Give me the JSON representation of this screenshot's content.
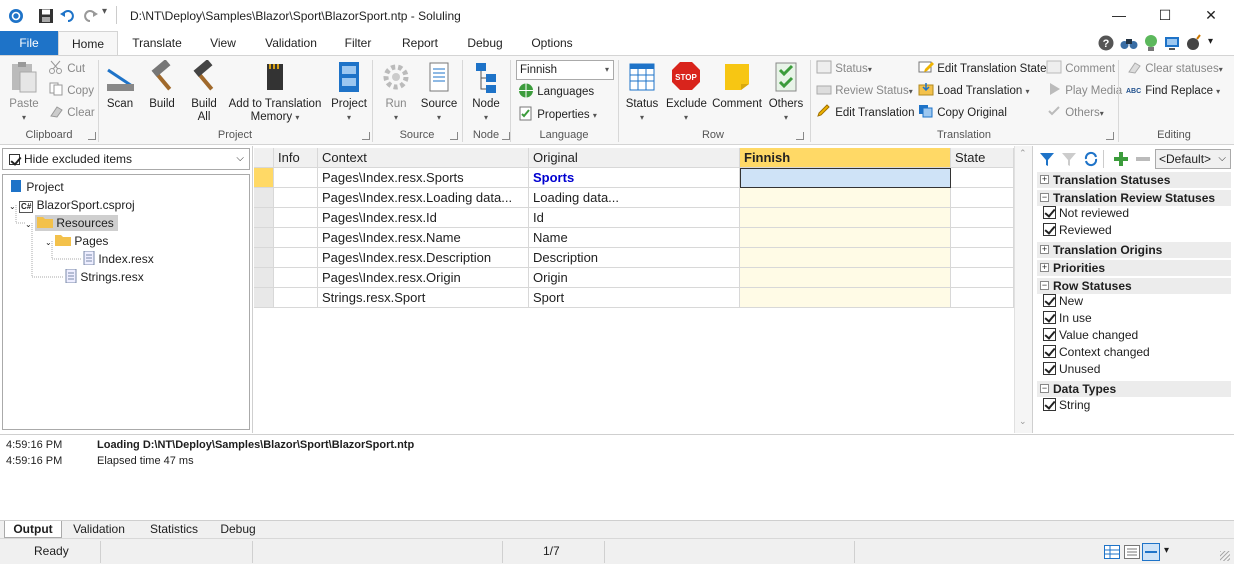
{
  "window": {
    "title": "D:\\NT\\Deploy\\Samples\\Blazor\\Sport\\BlazorSport.ntp  -  Soluling",
    "minimize": "—",
    "maximize": "☐",
    "close": "✕"
  },
  "tabs": [
    "File",
    "Home",
    "Translate",
    "View",
    "Validation",
    "Filter",
    "Report",
    "Debug",
    "Options"
  ],
  "ribbon": {
    "clipboard": {
      "paste": "Paste",
      "cut": "Cut",
      "copy": "Copy",
      "clear": "Clear",
      "label": "Clipboard"
    },
    "project": {
      "scan": "Scan",
      "build": "Build",
      "build_all_1": "Build",
      "build_all_2": "All",
      "add_tm_1": "Add to Translation",
      "add_tm_2": "Memory",
      "project": "Project",
      "label": "Project"
    },
    "source": {
      "run": "Run",
      "source": "Source",
      "label": "Source"
    },
    "node": {
      "node": "Node",
      "label": "Node"
    },
    "language": {
      "select": "Finnish",
      "languages": "Languages",
      "properties": "Properties",
      "label": "Language"
    },
    "row": {
      "status": "Status",
      "exclude": "Exclude",
      "comment": "Comment",
      "others": "Others",
      "label": "Row",
      "stop_text": "STOP"
    },
    "translation": {
      "status": "Status",
      "review_status": "Review Status",
      "edit_translation": "Edit Translation",
      "edit_state": "Edit Translation State",
      "load_translation": "Load Translation",
      "copy_original": "Copy Original",
      "comment": "Comment",
      "play_media": "Play Media",
      "others": "Others",
      "label": "Translation"
    },
    "editing": {
      "clear_statuses": "Clear statuses",
      "find_replace": "Find  Replace",
      "abc": "ABC",
      "label": "Editing"
    }
  },
  "left": {
    "filter": "Hide excluded items",
    "tree": [
      {
        "label": "Project",
        "icon": "project-icon"
      },
      {
        "label": "BlazorSport.csproj",
        "icon": "csharp-project-icon",
        "badge": "C#"
      },
      {
        "label": "Resources",
        "icon": "folder-icon"
      },
      {
        "label": "Pages",
        "icon": "folder-icon"
      },
      {
        "label": "Index.resx",
        "icon": "resx-file-icon"
      },
      {
        "label": "Strings.resx",
        "icon": "resx-file-icon"
      }
    ]
  },
  "grid": {
    "headers": [
      "Info",
      "Context",
      "Original",
      "Finnish",
      "State"
    ],
    "rows": [
      {
        "context": "Pages\\Index.resx.Sports",
        "original": "Sports"
      },
      {
        "context": "Pages\\Index.resx.Loading data...",
        "original": "Loading data..."
      },
      {
        "context": "Pages\\Index.resx.Id",
        "original": "Id"
      },
      {
        "context": "Pages\\Index.resx.Name",
        "original": "Name"
      },
      {
        "context": "Pages\\Index.resx.Description",
        "original": "Description"
      },
      {
        "context": "Pages\\Index.resx.Origin",
        "original": "Origin"
      },
      {
        "context": "Strings.resx.Sport",
        "original": "Sport"
      }
    ]
  },
  "right": {
    "preset": "<Default>",
    "sections": {
      "translation_statuses": "Translation Statuses",
      "review_statuses": "Translation Review Statuses",
      "origins": "Translation Origins",
      "priorities": "Priorities",
      "row_statuses": "Row Statuses",
      "data_types": "Data Types"
    },
    "review_items": [
      "Not reviewed",
      "Reviewed"
    ],
    "row_items": [
      "New",
      "In use",
      "Value changed",
      "Context changed",
      "Unused"
    ],
    "type_items": [
      "String"
    ]
  },
  "output": {
    "lines": [
      {
        "time": "4:59:16 PM",
        "text": "Loading D:\\NT\\Deploy\\Samples\\Blazor\\Sport\\BlazorSport.ntp"
      },
      {
        "time": "4:59:16 PM",
        "text": "Elapsed time 47 ms"
      }
    ],
    "tabs": [
      "Output",
      "Validation",
      "Statistics",
      "Debug"
    ]
  },
  "statusbar": {
    "ready": "Ready",
    "position": "1/7"
  },
  "colors": {
    "accent": "#1e73c8",
    "finnish_header": "#ffd966",
    "finnish_cell": "#fffbe6",
    "selected": "#cfe3f7"
  }
}
